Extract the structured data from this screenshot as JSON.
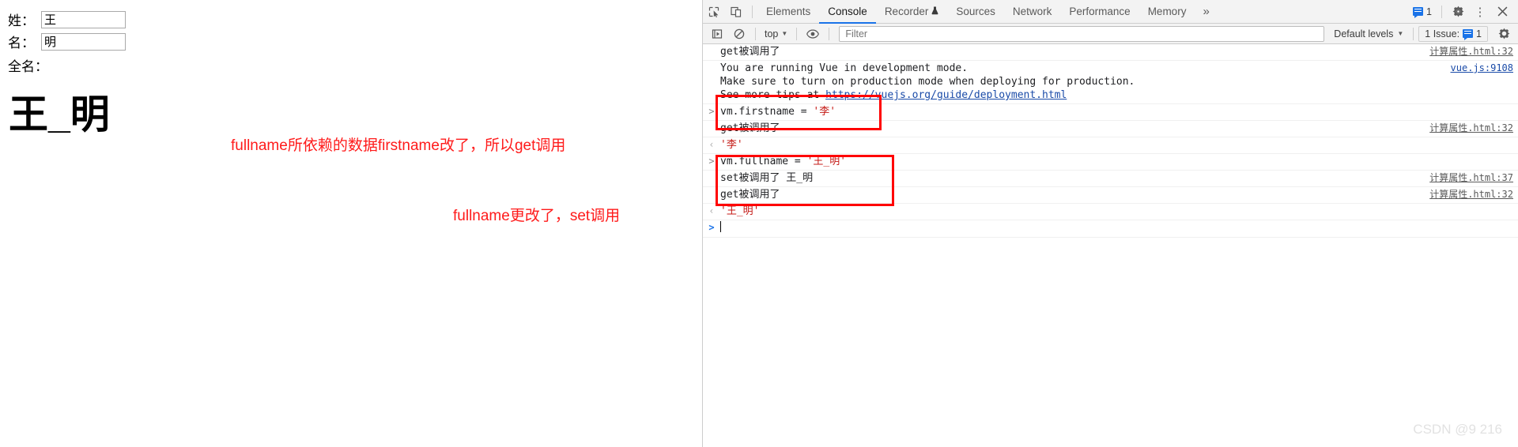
{
  "page": {
    "fields": [
      {
        "label": "姓：",
        "value": "王",
        "name": "lastname"
      },
      {
        "label": "名：",
        "value": "明",
        "name": "firstname"
      }
    ],
    "fullname_label": "全名：",
    "fullname_display": "王_明",
    "annotations": [
      {
        "text": "fullname所依赖的数据firstname改了，所以get调用",
        "color": "#ff1a1a"
      },
      {
        "text": "fullname更改了，set调用",
        "color": "#ff1a1a"
      }
    ]
  },
  "devtools": {
    "icons": {
      "inspect": "inspect-element-icon",
      "device": "device-toolbar-icon",
      "gear": "gear-icon",
      "kebab": "kebab-menu-icon",
      "close": "close-icon",
      "more_tabs": "chevron-double-right-icon",
      "execute": "execute-snippet-icon",
      "clear": "clear-console-icon",
      "eye": "live-expression-icon",
      "caret": "chevron-down-icon"
    },
    "tabs": [
      {
        "label": "Elements",
        "active": false
      },
      {
        "label": "Console",
        "active": true
      },
      {
        "label": "Recorder",
        "active": false,
        "badge": "flask-icon"
      },
      {
        "label": "Sources",
        "active": false
      },
      {
        "label": "Network",
        "active": false
      },
      {
        "label": "Performance",
        "active": false
      },
      {
        "label": "Memory",
        "active": false
      }
    ],
    "more_tabs_glyph": "»",
    "message_count": "1",
    "console_toolbar": {
      "context": "top",
      "filter_placeholder": "Filter",
      "filter_value": "",
      "levels": "Default levels",
      "issues": "1 Issue:",
      "issues_count": "1"
    },
    "messages": [
      {
        "kind": "log",
        "gutter": "",
        "text": "get被调用了",
        "source": "计算属性.html:32"
      },
      {
        "kind": "log-multiline",
        "gutter": "",
        "lines": [
          "You are running Vue in development mode.",
          "Make sure to turn on production mode when deploying for production.",
          "See more tips at "
        ],
        "link": "https://vuejs.org/guide/deployment.html",
        "source": "vue.js:9108"
      },
      {
        "kind": "input",
        "gutter": ">",
        "text_pre": "vm.firstname = ",
        "text_lit": "'李'",
        "source": ""
      },
      {
        "kind": "log",
        "gutter": "",
        "text": "get被调用了",
        "source": "计算属性.html:32"
      },
      {
        "kind": "output",
        "gutter": "‹",
        "text": "'李'",
        "source": ""
      },
      {
        "kind": "input",
        "gutter": ">",
        "text_pre": "vm.fullname = ",
        "text_lit": "'王_明'",
        "source": ""
      },
      {
        "kind": "log",
        "gutter": "",
        "text": "set被调用了 王_明",
        "source": "计算属性.html:37"
      },
      {
        "kind": "log",
        "gutter": "",
        "text": "get被调用了",
        "source": "计算属性.html:32"
      },
      {
        "kind": "output",
        "gutter": "‹",
        "text": "'王_明'",
        "source": ""
      },
      {
        "kind": "prompt",
        "gutter": ">",
        "text": "",
        "source": ""
      }
    ],
    "highlight_color": "#ff0000"
  },
  "watermark": "CSDN @9 216"
}
